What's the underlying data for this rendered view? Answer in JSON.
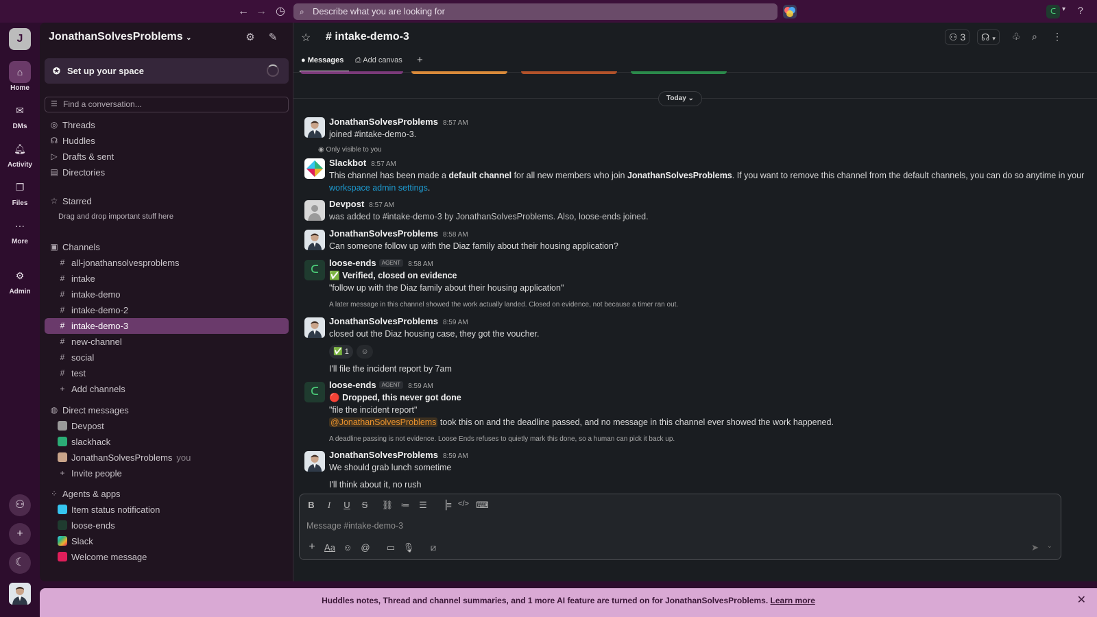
{
  "search": {
    "placeholder": "Describe what you are looking for"
  },
  "rail": {
    "workspace_initial": "J",
    "items": [
      {
        "label": "Home"
      },
      {
        "label": "DMs"
      },
      {
        "label": "Activity"
      },
      {
        "label": "Files"
      },
      {
        "label": "More"
      },
      {
        "label": "Admin"
      }
    ]
  },
  "sidebar": {
    "workspace_name": "JonathanSolvesProblems",
    "setup_label": "Set up your space",
    "find_placeholder": "Find a conversation...",
    "nav": [
      "Threads",
      "Huddles",
      "Drafts & sent",
      "Directories"
    ],
    "starred_header": "Starred",
    "starred_hint": "Drag and drop important stuff here",
    "channels_header": "Channels",
    "channels": [
      "all-jonathansolvesproblems",
      "intake",
      "intake-demo",
      "intake-demo-2",
      "intake-demo-3",
      "new-channel",
      "social",
      "test"
    ],
    "active_channel": "intake-demo-3",
    "add_channels": "Add channels",
    "dms_header": "Direct messages",
    "dms": [
      "Devpost",
      "slackhack",
      "JonathanSolvesProblems"
    ],
    "you_label": "you",
    "invite": "Invite people",
    "apps_header": "Agents & apps",
    "apps": [
      "Item status notification",
      "loose-ends",
      "Slack",
      "Welcome message"
    ]
  },
  "channel": {
    "title": "# intake-demo-3",
    "member_count": "3",
    "tabs": {
      "messages": "Messages",
      "add_canvas": "Add canvas"
    },
    "date_divider": "Today"
  },
  "messages": [
    {
      "author": "JonathanSolvesProblems",
      "time": "8:57 AM",
      "text": "joined #intake-demo-3."
    },
    {
      "visibility_note": "Only visible to you",
      "author": "Slackbot",
      "time": "8:57 AM",
      "text_1": "This channel has been made a ",
      "bold_1": "default channel",
      "text_2": " for all new members who join ",
      "bold_2": "JonathanSolvesProblems",
      "text_3": ". If you want to remove this channel from the default channels, you can do so anytime in your",
      "link": "workspace admin settings",
      "text_4": "."
    },
    {
      "author": "Devpost",
      "time": "8:57 AM",
      "text": "was added to #intake-demo-3 by JonathanSolvesProblems. Also, loose-ends joined."
    },
    {
      "author": "JonathanSolvesProblems",
      "time": "8:58 AM",
      "text": "Can someone follow up with the Diaz family about their housing application?"
    },
    {
      "author": "loose-ends",
      "tag": "AGENT",
      "time": "8:58 AM",
      "headline_emoji": "✅",
      "headline": "Verified, closed on evidence",
      "quote": "\"follow up with the Diaz family about their housing application\"",
      "note": "A later message in this channel showed the work actually landed. Closed on evidence, not because a timer ran out."
    },
    {
      "author": "JonathanSolvesProblems",
      "time": "8:59 AM",
      "text": "closed out the Diaz housing case, they got the voucher.",
      "reaction": "✅ 1",
      "followup": "I'll file the incident report by 7am"
    },
    {
      "author": "loose-ends",
      "tag": "AGENT",
      "time": "8:59 AM",
      "headline_emoji": "🔴",
      "headline": "Dropped, this never got done",
      "quote": "\"file the incident report\"",
      "mention": "@JonathanSolvesProblems",
      "mention_rest": " took this on and the deadline passed, and no message in this channel ever showed the work happened.",
      "note": "A deadline passing is not evidence. Loose Ends refuses to quietly mark this done, so a human can pick it back up."
    },
    {
      "author": "JonathanSolvesProblems",
      "time": "8:59 AM",
      "text": "We should grab lunch sometime",
      "followup": "I'll think about it, no rush"
    }
  ],
  "composer": {
    "placeholder": "Message #intake-demo-3"
  },
  "banner": {
    "text": "Huddles notes, Thread and channel summaries, and 1 more AI feature are turned on for JonathanSolvesProblems. ",
    "link": "Learn more"
  },
  "colors": {
    "accent": "#6a3a6b",
    "link": "#1d9bd1",
    "mention": "#e8912d",
    "banner": "#d9a9d4",
    "agent_avatar": "#1f3b2f"
  }
}
